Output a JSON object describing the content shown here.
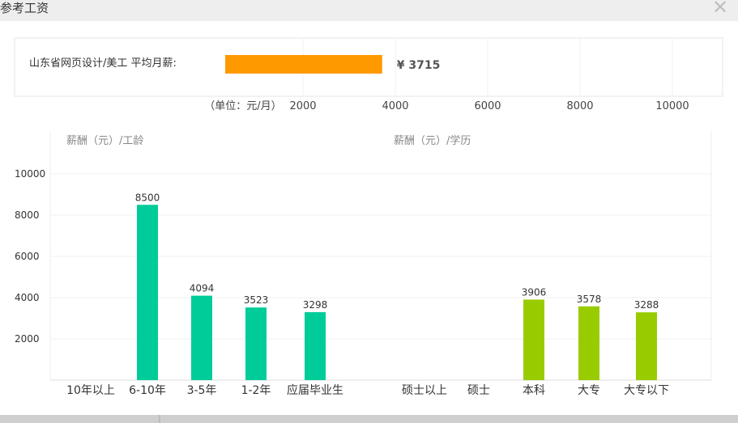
{
  "dialog": {
    "title": "参考工资",
    "close_glyph": "✕"
  },
  "chart_data": [
    {
      "type": "bar",
      "orientation": "horizontal",
      "categories": [
        "山东省网页设计/美工  平均月薪:"
      ],
      "values": [
        3715
      ],
      "value_label": "¥ 3715",
      "unit_label": "（单位：元/月）",
      "xticks": [
        2000,
        4000,
        6000,
        8000,
        10000
      ],
      "xlim": [
        0,
        10000
      ],
      "bar_color": "#ff9900",
      "grid": true
    },
    {
      "type": "bar",
      "title": "薪酬（元）/工龄",
      "categories": [
        "10年以上",
        "6-10年",
        "3-5年",
        "1-2年",
        "应届毕业生"
      ],
      "values": [
        null,
        8500,
        4094,
        3523,
        3298
      ],
      "yticks": [
        2000,
        4000,
        6000,
        8000,
        10000
      ],
      "ylim": [
        0,
        10000
      ],
      "bar_color": "#00cc99",
      "grid": true
    },
    {
      "type": "bar",
      "title": "薪酬（元）/学历",
      "categories": [
        "硕士以上",
        "硕士",
        "本科",
        "大专",
        "大专以下"
      ],
      "values": [
        null,
        null,
        3906,
        3578,
        3288
      ],
      "ylim": [
        0,
        10000
      ],
      "bar_color": "#99cc00",
      "grid": true
    }
  ]
}
